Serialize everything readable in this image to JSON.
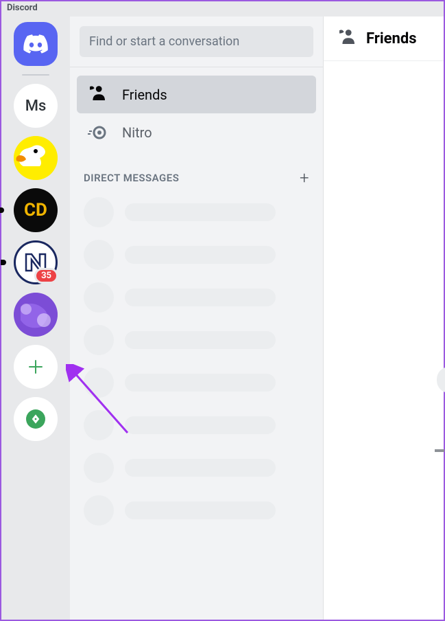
{
  "app": {
    "title": "Discord"
  },
  "servers": {
    "ms_label": "Ms",
    "cd_label": "CD",
    "nm_badge": "35"
  },
  "search": {
    "placeholder": "Find or start a conversation"
  },
  "nav": {
    "friends": "Friends",
    "nitro": "Nitro"
  },
  "dm": {
    "header": "DIRECT MESSAGES"
  },
  "content": {
    "title": "Friends"
  }
}
